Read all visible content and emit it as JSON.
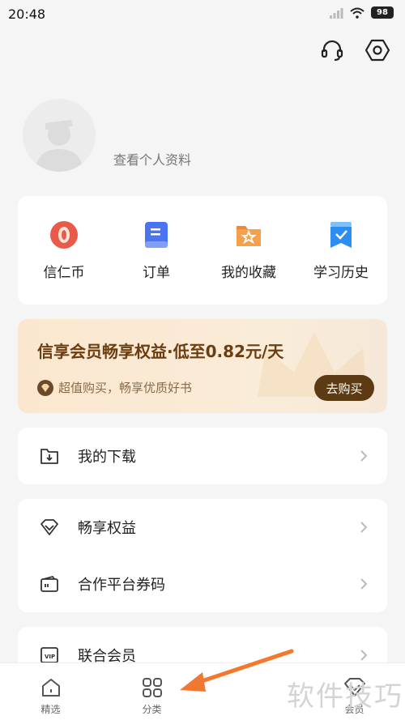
{
  "status_bar": {
    "time": "20:48",
    "battery": "98"
  },
  "top_actions": {
    "support_icon": "headset-icon",
    "settings_icon": "hexagon-gear-icon"
  },
  "profile": {
    "link_text": "查看个人资料"
  },
  "shortcuts": [
    {
      "label": "信仁币",
      "icon": "coin-icon",
      "color": "#e85b4a"
    },
    {
      "label": "订单",
      "icon": "order-icon",
      "color": "#4a74f0"
    },
    {
      "label": "我的收藏",
      "icon": "favorite-folder-icon",
      "color": "#f08a30"
    },
    {
      "label": "学习历史",
      "icon": "history-bookmark-icon",
      "color": "#2e8ef0"
    }
  ],
  "vip_banner": {
    "title": "信享会员畅享权益·低至0.82元/天",
    "subtitle": "超值购买，畅享优质好书",
    "button": "去购买"
  },
  "menu": {
    "downloads": "我的下载",
    "benefits": "畅享权益",
    "coupons": "合作平台券码",
    "joint_vip": "联合会员"
  },
  "bottom_nav": [
    {
      "label": "精选"
    },
    {
      "label": "分类"
    },
    {
      "label": ""
    },
    {
      "label": "会员"
    }
  ],
  "watermark": "软件技巧"
}
